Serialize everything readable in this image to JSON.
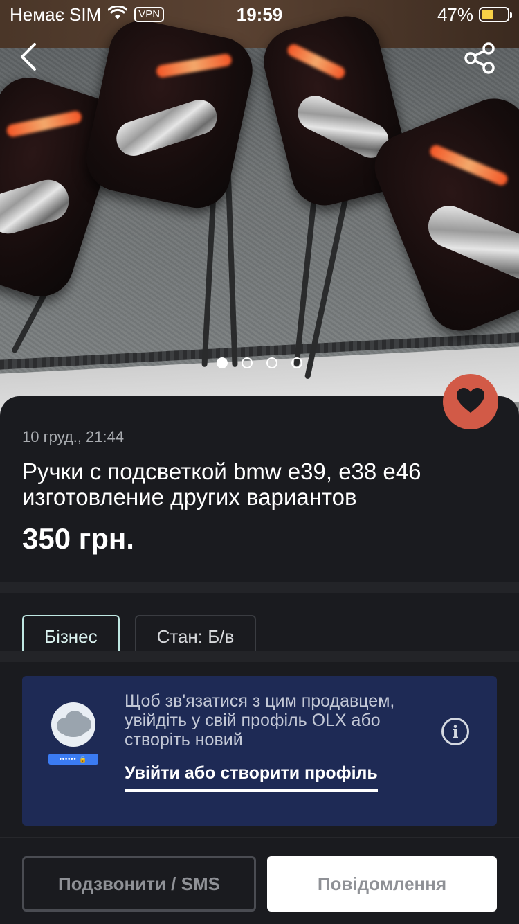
{
  "status_bar": {
    "carrier": "Немає SIM",
    "vpn": "VPN",
    "time": "19:59",
    "battery_percent": "47%",
    "battery_level": 0.47
  },
  "gallery": {
    "image_count": 4,
    "active_index": 0,
    "back_icon": "chevron-left-icon",
    "share_icon": "share-icon"
  },
  "listing": {
    "date": "10 груд., 21:44",
    "title": "Ручки с подсветкой bmw e39, e38 e46 изготовление других вариантов",
    "price": "350 грн.",
    "favorite_icon": "heart-icon",
    "favorite_color": "#d25a47"
  },
  "tags": [
    {
      "label": "Бізнес"
    },
    {
      "label": "Стан: Б/в"
    }
  ],
  "login_prompt": {
    "message": "Щоб зв'язатися з цим продавцем, увійдіть у свій профіль OLX або створіть новий",
    "link": "Увійти або створити профіль",
    "password_mask": "•••••• 🔒",
    "box_color": "#1e2a55"
  },
  "actions": {
    "call_label": "Подзвонити / SMS",
    "message_label": "Повідомлення"
  }
}
